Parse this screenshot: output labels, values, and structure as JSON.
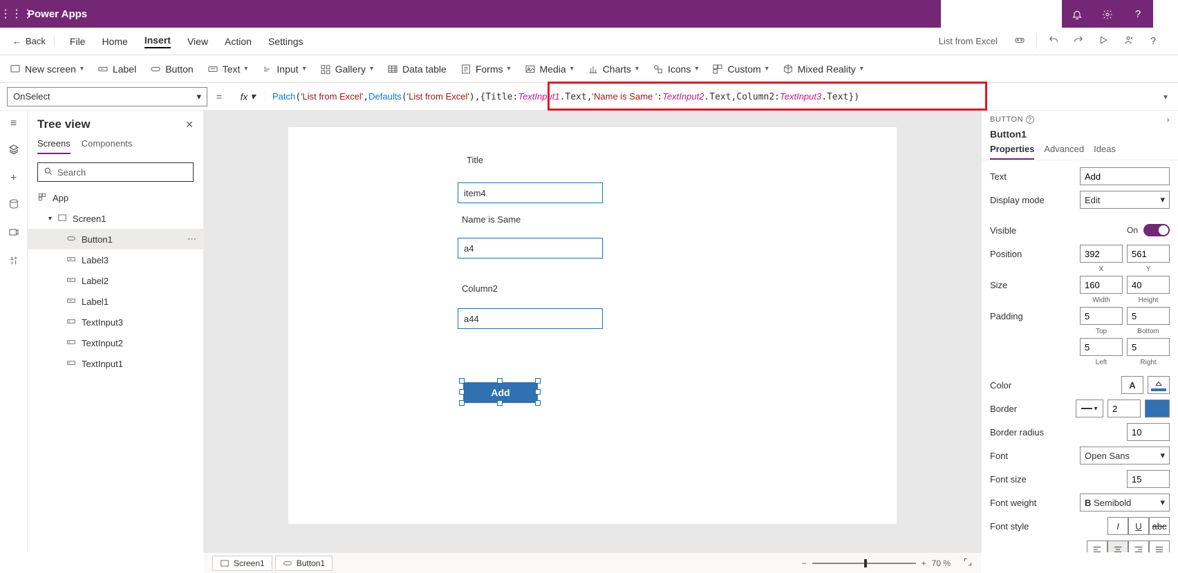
{
  "header": {
    "brand": "Power Apps"
  },
  "menubar": {
    "back": "Back",
    "items": [
      "File",
      "Home",
      "Insert",
      "View",
      "Action",
      "Settings"
    ],
    "active": "Insert",
    "appname": "List from Excel"
  },
  "ribbon": {
    "newscreen": "New screen",
    "label": "Label",
    "button": "Button",
    "text": "Text",
    "input": "Input",
    "gallery": "Gallery",
    "datatable": "Data table",
    "forms": "Forms",
    "media": "Media",
    "charts": "Charts",
    "icons": "Icons",
    "custom": "Custom",
    "mixedreality": "Mixed Reality"
  },
  "fxbar": {
    "property": "OnSelect",
    "formula_html": "<span class='tok-fn'>Patch</span>(<span class='tok-str'>'List from Excel'</span>,<span class='tok-fn'>Defaults</span>(<span class='tok-str'>'List from Excel'</span>),{Title:<span class='tok-var'>TextInput1</span>.Text,<span class='tok-str'>'Name is Same '</span>:<span class='tok-var'>TextInput2</span>.Text,Column2:<span class='tok-var'>TextInput3</span>.Text})"
  },
  "tree": {
    "title": "Tree view",
    "tabs": {
      "screens": "Screens",
      "components": "Components"
    },
    "search": "Search",
    "app": "App",
    "screen": "Screen1",
    "items": [
      "Button1",
      "Label3",
      "Label2",
      "Label1",
      "TextInput3",
      "TextInput2",
      "TextInput1"
    ],
    "selected": "Button1"
  },
  "canvas": {
    "title_lbl": "Title",
    "title_val": "item4",
    "name_lbl": "Name is Same",
    "name_val": "a4",
    "col_lbl": "Column2",
    "col_val": "a44",
    "add_btn": "Add"
  },
  "props": {
    "type": "BUTTON",
    "name": "Button1",
    "tabs": {
      "properties": "Properties",
      "advanced": "Advanced",
      "ideas": "Ideas"
    },
    "text_lbl": "Text",
    "text_val": "Add",
    "display_lbl": "Display mode",
    "display_val": "Edit",
    "visible_lbl": "Visible",
    "visible_state": "On",
    "position_lbl": "Position",
    "pos_x": "392",
    "pos_y": "561",
    "pos_xl": "X",
    "pos_yl": "Y",
    "size_lbl": "Size",
    "size_w": "160",
    "size_h": "40",
    "size_wl": "Width",
    "size_hl": "Height",
    "padding_lbl": "Padding",
    "pad_t": "5",
    "pad_b": "5",
    "pad_l": "5",
    "pad_r": "5",
    "pad_tl": "Top",
    "pad_bl": "Bottom",
    "pad_ll": "Left",
    "pad_rl": "Right",
    "color_lbl": "Color",
    "border_lbl": "Border",
    "border_w": "2",
    "radius_lbl": "Border radius",
    "radius_val": "10",
    "font_lbl": "Font",
    "font_val": "Open Sans",
    "fontsize_lbl": "Font size",
    "fontsize_val": "15",
    "fontweight_lbl": "Font weight",
    "fontweight_val": "Semibold",
    "fontstyle_lbl": "Font style"
  },
  "status": {
    "screen": "Screen1",
    "element": "Button1",
    "zoom": "70 %"
  }
}
